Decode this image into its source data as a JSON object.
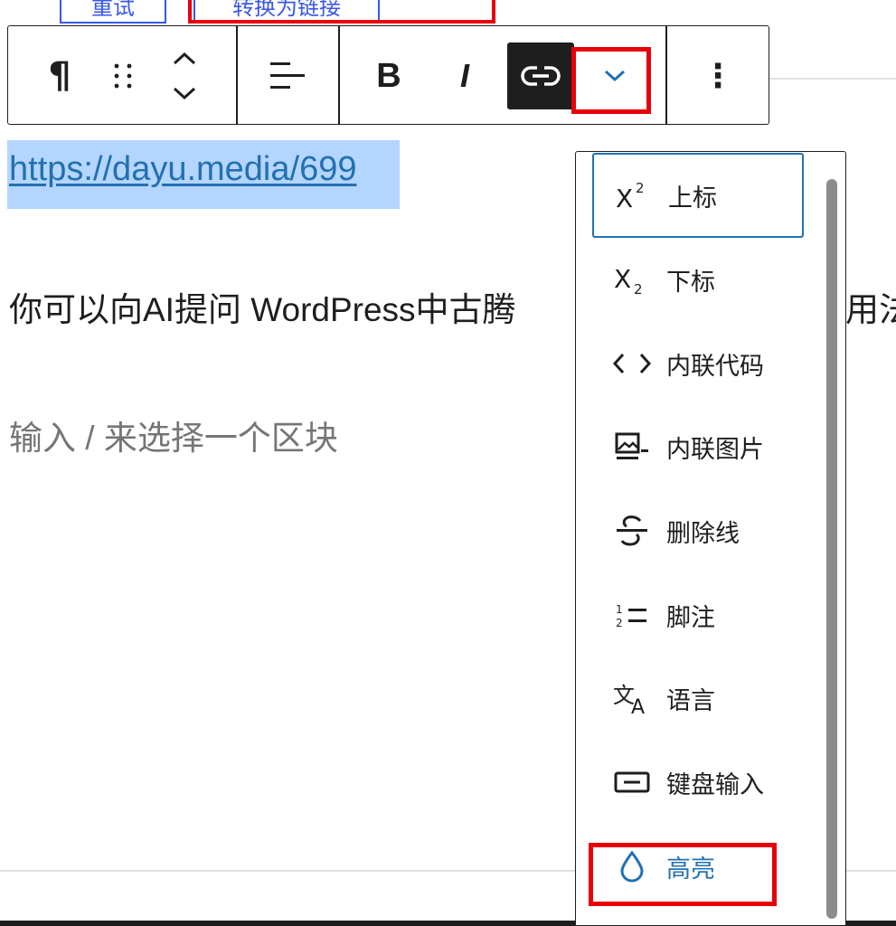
{
  "top_buttons": {
    "retry": "重试",
    "convert_to_link": "转换为链接"
  },
  "toolbar": {
    "paragraph": "¶",
    "bold": "B",
    "italic": "I",
    "more_options": "⋮"
  },
  "content": {
    "link_url": "https://dayu.media/699",
    "paragraph": "你可以向AI提问 WordPress中古腾",
    "paragraph_tail": "用法",
    "placeholder": "输入 / 来选择一个区块"
  },
  "menu": {
    "items": [
      {
        "label": "上标",
        "icon": "superscript-icon"
      },
      {
        "label": "下标",
        "icon": "subscript-icon"
      },
      {
        "label": "内联代码",
        "icon": "code-icon"
      },
      {
        "label": "内联图片",
        "icon": "inline-image-icon"
      },
      {
        "label": "删除线",
        "icon": "strikethrough-icon"
      },
      {
        "label": "脚注",
        "icon": "footnote-icon"
      },
      {
        "label": "语言",
        "icon": "language-icon"
      },
      {
        "label": "键盘输入",
        "icon": "keyboard-input-icon"
      },
      {
        "label": "高亮",
        "icon": "highlight-icon"
      }
    ]
  },
  "colors": {
    "accent": "#2271b1",
    "highlight_frame": "#e8000b",
    "selection": "#b4d5fe",
    "dark": "#1e1e1e"
  }
}
